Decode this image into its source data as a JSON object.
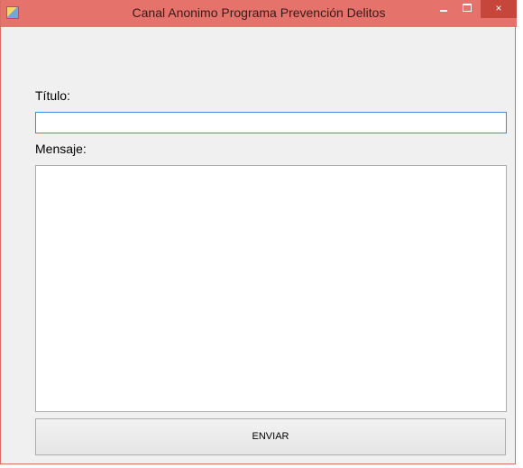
{
  "window": {
    "title": "Canal Anonimo Programa Prevención Delitos",
    "controls": {
      "minimize": "minimize",
      "maximize": "maximize",
      "close": "×"
    }
  },
  "form": {
    "title_label": "Título:",
    "title_value": "",
    "message_label": "Mensaje:",
    "message_value": "",
    "submit_label": "ENVIAR"
  },
  "icons": {
    "app": "app-icon",
    "minimize": "minimize-icon",
    "maximize": "maximize-icon",
    "close": "close-icon"
  },
  "colors": {
    "titlebar": "#e5736b",
    "close_button": "#c7463b",
    "window_background": "#f0f0f0",
    "input_focus_border": "#3c8ed6"
  }
}
